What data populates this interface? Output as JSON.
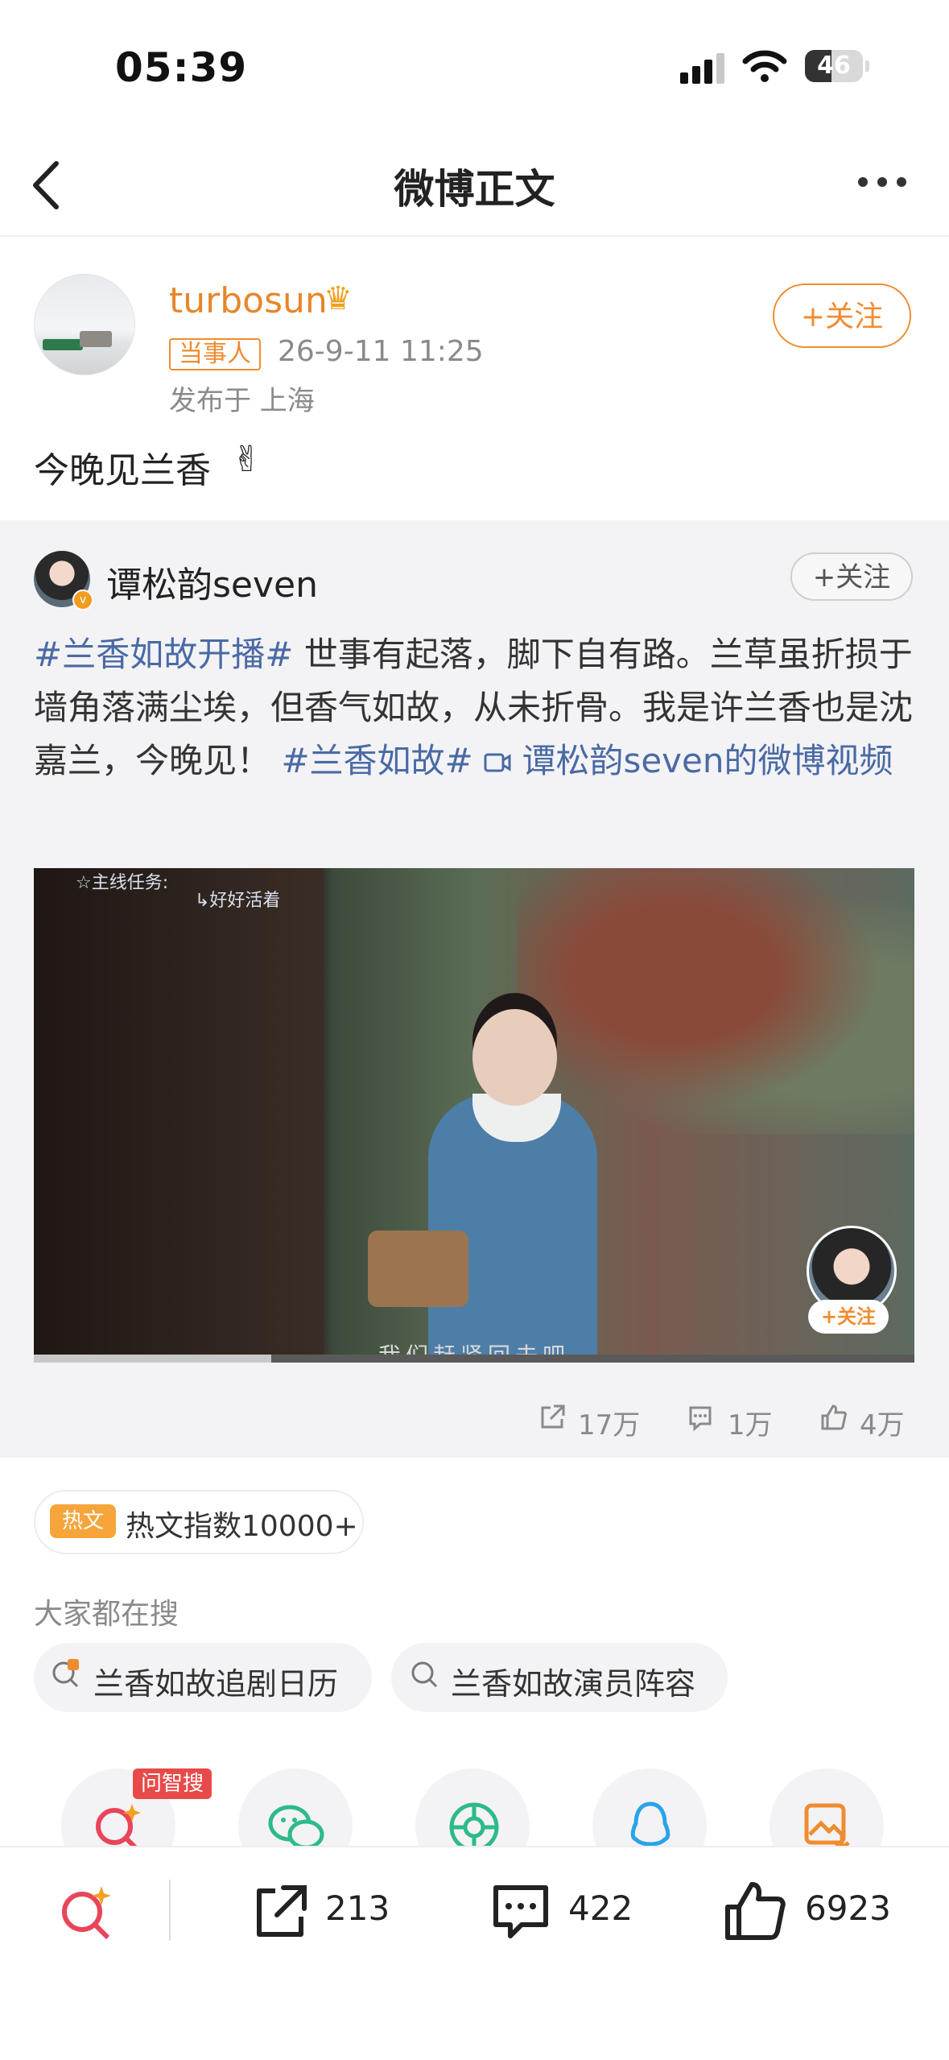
{
  "status_bar": {
    "time": "05:39",
    "battery": "46",
    "battery_level": 0.46
  },
  "nav": {
    "title": "微博正文",
    "back_icon": "chevron-left-icon",
    "more_icon": "more-dots-icon"
  },
  "post": {
    "author_name": "turbosun",
    "role_badge": "当事人",
    "time": "26-9-11 11:25",
    "location": "发布于 上海",
    "follow_label": "+关注",
    "text": "今晚见兰香",
    "emoji": "✌"
  },
  "repost": {
    "author_name": "谭松韵seven",
    "follow_label": "+关注",
    "text_parts": {
      "hashtag1": "#兰香如故开播#",
      "body": " 世事有起落，脚下自有路。兰草虽折损于墙角落满尘埃，但香气如故，从未折骨。我是许兰香也是沈嘉兰，今晚见！ ",
      "hashtag2": "#兰香如故#",
      "video_link": " 谭松韵seven的微博视频"
    },
    "video": {
      "mission_label": "☆主线任务:",
      "mission_sub": "↳好好活着",
      "subtitle": "我们赶紧回去吧",
      "host_follow": "+关注",
      "progress": 0.27
    },
    "stats": {
      "reposts": "17万",
      "comments": "1万",
      "likes": "4万"
    }
  },
  "hot": {
    "tag": "热文",
    "text": "热文指数10000+"
  },
  "search": {
    "title": "大家都在搜",
    "chips": [
      "兰香如故追剧日历",
      "兰香如故演员阵容"
    ]
  },
  "share": {
    "ask_badge": "问智搜"
  },
  "bottom_bar": {
    "reposts": "213",
    "comments": "422",
    "likes": "6923"
  }
}
